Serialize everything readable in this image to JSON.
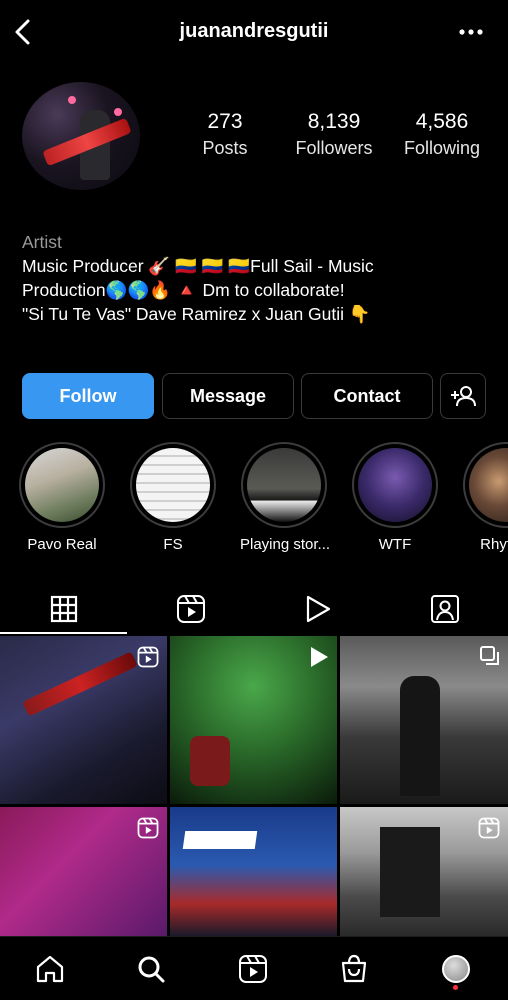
{
  "header": {
    "username": "juanandresgutii"
  },
  "profile": {
    "stats": [
      {
        "value": "273",
        "label": "Posts"
      },
      {
        "value": "8,139",
        "label": "Followers"
      },
      {
        "value": "4,586",
        "label": "Following"
      }
    ],
    "category": "Artist",
    "bio_lines": [
      "Music Producer 🎸 🇨🇴 🇨🇴 🇨🇴Full Sail - Music",
      "Production🌎🌎🔥 🔺 Dm to collaborate!",
      "\"Si Tu Te Vas\" Dave Ramirez x Juan Gutii  👇"
    ]
  },
  "actions": {
    "follow": "Follow",
    "message": "Message",
    "contact": "Contact"
  },
  "highlights": [
    {
      "label": "Pavo Real"
    },
    {
      "label": "FS"
    },
    {
      "label": "Playing stor..."
    },
    {
      "label": "WTF"
    },
    {
      "label": "Rhythm"
    }
  ],
  "colors": {
    "accent": "#3897f0",
    "background": "#000000"
  },
  "icons": {
    "back": "chevron-left-icon",
    "more": "more-horizontal-icon",
    "add_user": "add-user-icon",
    "grid": "grid-icon",
    "reels": "reels-icon",
    "video": "play-icon",
    "tagged": "tagged-icon",
    "home": "home-icon",
    "search": "search-icon",
    "shop": "shopping-bag-icon"
  }
}
